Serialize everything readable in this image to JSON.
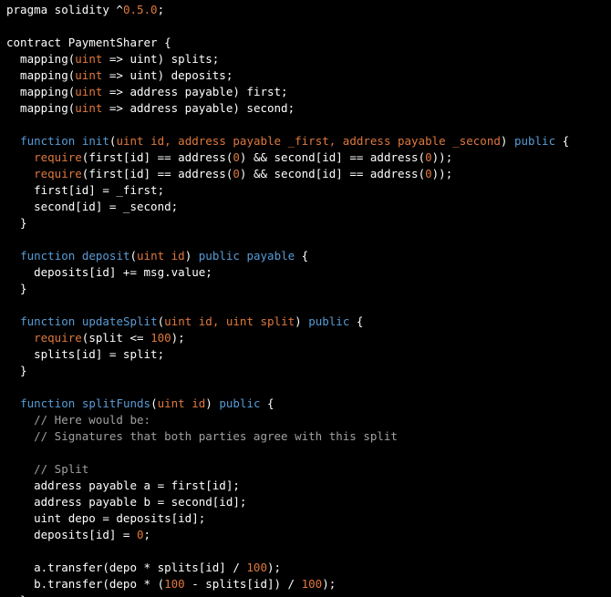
{
  "colors": {
    "plain": "#ffffff",
    "keyword": "#569cd6",
    "function": "#5b9bd5",
    "type": "#e0783c",
    "builtin": "#e0783c",
    "number": "#e0783c",
    "param": "#e0783c",
    "comment": "#a0a0a0",
    "background": "#000000"
  },
  "code": {
    "lines": [
      [
        [
          "plain",
          "pragma solidity ^"
        ],
        [
          "number",
          "0.5.0"
        ],
        [
          "plain",
          ";"
        ]
      ],
      [],
      [
        [
          "plain",
          "contract PaymentSharer {"
        ]
      ],
      [
        [
          "plain",
          "  mapping("
        ],
        [
          "type",
          "uint"
        ],
        [
          "plain",
          " => uint) splits;"
        ]
      ],
      [
        [
          "plain",
          "  mapping("
        ],
        [
          "type",
          "uint"
        ],
        [
          "plain",
          " => uint) deposits;"
        ]
      ],
      [
        [
          "plain",
          "  mapping("
        ],
        [
          "type",
          "uint"
        ],
        [
          "plain",
          " => address payable) first;"
        ]
      ],
      [
        [
          "plain",
          "  mapping("
        ],
        [
          "type",
          "uint"
        ],
        [
          "plain",
          " => address payable) second;"
        ]
      ],
      [],
      [
        [
          "plain",
          "  "
        ],
        [
          "keyword",
          "function"
        ],
        [
          "plain",
          " "
        ],
        [
          "function",
          "init"
        ],
        [
          "plain",
          "("
        ],
        [
          "param",
          "uint id, address payable _first, address payable _second"
        ],
        [
          "plain",
          ") "
        ],
        [
          "keyword",
          "public"
        ],
        [
          "plain",
          " {"
        ]
      ],
      [
        [
          "plain",
          "    "
        ],
        [
          "builtin",
          "require"
        ],
        [
          "plain",
          "(first[id] == address("
        ],
        [
          "number",
          "0"
        ],
        [
          "plain",
          ") && second[id] == address("
        ],
        [
          "number",
          "0"
        ],
        [
          "plain",
          "));"
        ]
      ],
      [
        [
          "plain",
          "    "
        ],
        [
          "builtin",
          "require"
        ],
        [
          "plain",
          "(first[id] == address("
        ],
        [
          "number",
          "0"
        ],
        [
          "plain",
          ") && second[id] == address("
        ],
        [
          "number",
          "0"
        ],
        [
          "plain",
          "));"
        ]
      ],
      [
        [
          "plain",
          "    first[id] = _first;"
        ]
      ],
      [
        [
          "plain",
          "    second[id] = _second;"
        ]
      ],
      [
        [
          "plain",
          "  }"
        ]
      ],
      [],
      [
        [
          "plain",
          "  "
        ],
        [
          "keyword",
          "function"
        ],
        [
          "plain",
          " "
        ],
        [
          "function",
          "deposit"
        ],
        [
          "plain",
          "("
        ],
        [
          "param",
          "uint id"
        ],
        [
          "plain",
          ") "
        ],
        [
          "keyword",
          "public payable"
        ],
        [
          "plain",
          " {"
        ]
      ],
      [
        [
          "plain",
          "    deposits[id] += msg.value;"
        ]
      ],
      [
        [
          "plain",
          "  }"
        ]
      ],
      [],
      [
        [
          "plain",
          "  "
        ],
        [
          "keyword",
          "function"
        ],
        [
          "plain",
          " "
        ],
        [
          "function",
          "updateSplit"
        ],
        [
          "plain",
          "("
        ],
        [
          "param",
          "uint id, uint split"
        ],
        [
          "plain",
          ") "
        ],
        [
          "keyword",
          "public"
        ],
        [
          "plain",
          " {"
        ]
      ],
      [
        [
          "plain",
          "    "
        ],
        [
          "builtin",
          "require"
        ],
        [
          "plain",
          "(split <= "
        ],
        [
          "number",
          "100"
        ],
        [
          "plain",
          ");"
        ]
      ],
      [
        [
          "plain",
          "    splits[id] = split;"
        ]
      ],
      [
        [
          "plain",
          "  }"
        ]
      ],
      [],
      [
        [
          "plain",
          "  "
        ],
        [
          "keyword",
          "function"
        ],
        [
          "plain",
          " "
        ],
        [
          "function",
          "splitFunds"
        ],
        [
          "plain",
          "("
        ],
        [
          "param",
          "uint id"
        ],
        [
          "plain",
          ") "
        ],
        [
          "keyword",
          "public"
        ],
        [
          "plain",
          " {"
        ]
      ],
      [
        [
          "comment",
          "    // Here would be:"
        ]
      ],
      [
        [
          "comment",
          "    // Signatures that both parties agree with this split"
        ]
      ],
      [],
      [
        [
          "comment",
          "    // Split"
        ]
      ],
      [
        [
          "plain",
          "    address payable a = first[id];"
        ]
      ],
      [
        [
          "plain",
          "    address payable b = second[id];"
        ]
      ],
      [
        [
          "plain",
          "    uint depo = deposits[id];"
        ]
      ],
      [
        [
          "plain",
          "    deposits[id] = "
        ],
        [
          "number",
          "0"
        ],
        [
          "plain",
          ";"
        ]
      ],
      [],
      [
        [
          "plain",
          "    a.transfer(depo * splits[id] / "
        ],
        [
          "number",
          "100"
        ],
        [
          "plain",
          ");"
        ]
      ],
      [
        [
          "plain",
          "    b.transfer(depo * ("
        ],
        [
          "number",
          "100"
        ],
        [
          "plain",
          " - splits[id]) / "
        ],
        [
          "number",
          "100"
        ],
        [
          "plain",
          ");"
        ]
      ],
      [
        [
          "plain",
          "  }"
        ]
      ]
    ]
  }
}
